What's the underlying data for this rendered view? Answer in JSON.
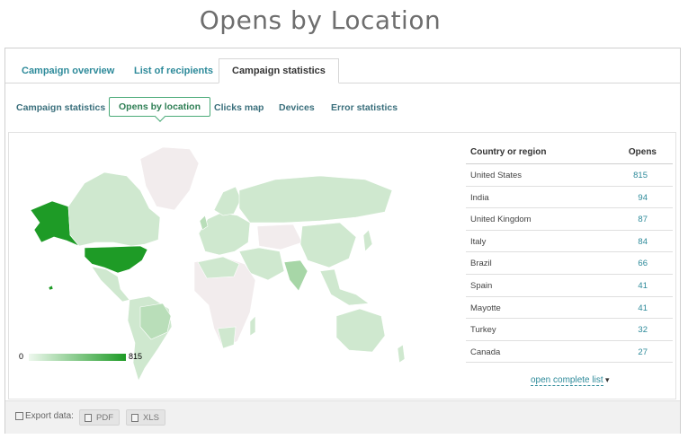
{
  "page": {
    "title": "Opens by Location"
  },
  "tabs": [
    {
      "label": "Campaign overview",
      "active": false
    },
    {
      "label": "List of recipients",
      "active": false
    },
    {
      "label": "Campaign statistics",
      "active": true
    }
  ],
  "subtabs": [
    {
      "label": "Campaign statistics",
      "active": false
    },
    {
      "label": "Opens by location",
      "active": true
    },
    {
      "label": "Clicks map",
      "active": false
    },
    {
      "label": "Devices",
      "active": false
    },
    {
      "label": "Error statistics",
      "active": false
    }
  ],
  "map": {
    "legend_min": "0",
    "legend_max": "815",
    "colors": {
      "max": "#1e9b26",
      "low": "#cfe8cf",
      "none": "#f2eced"
    }
  },
  "table": {
    "col_country": "Country or region",
    "col_opens": "Opens",
    "rows": [
      {
        "country": "United States",
        "opens": "815"
      },
      {
        "country": "India",
        "opens": "94"
      },
      {
        "country": "United Kingdom",
        "opens": "87"
      },
      {
        "country": "Italy",
        "opens": "84"
      },
      {
        "country": "Brazil",
        "opens": "66"
      },
      {
        "country": "Spain",
        "opens": "41"
      },
      {
        "country": "Mayotte",
        "opens": "41"
      },
      {
        "country": "Turkey",
        "opens": "32"
      },
      {
        "country": "Canada",
        "opens": "27"
      }
    ],
    "open_complete_list": "open complete list",
    "open_complete_caret": "▾"
  },
  "footer": {
    "export_label": "Export data:",
    "pdf_label": "PDF",
    "xls_label": "XLS"
  }
}
